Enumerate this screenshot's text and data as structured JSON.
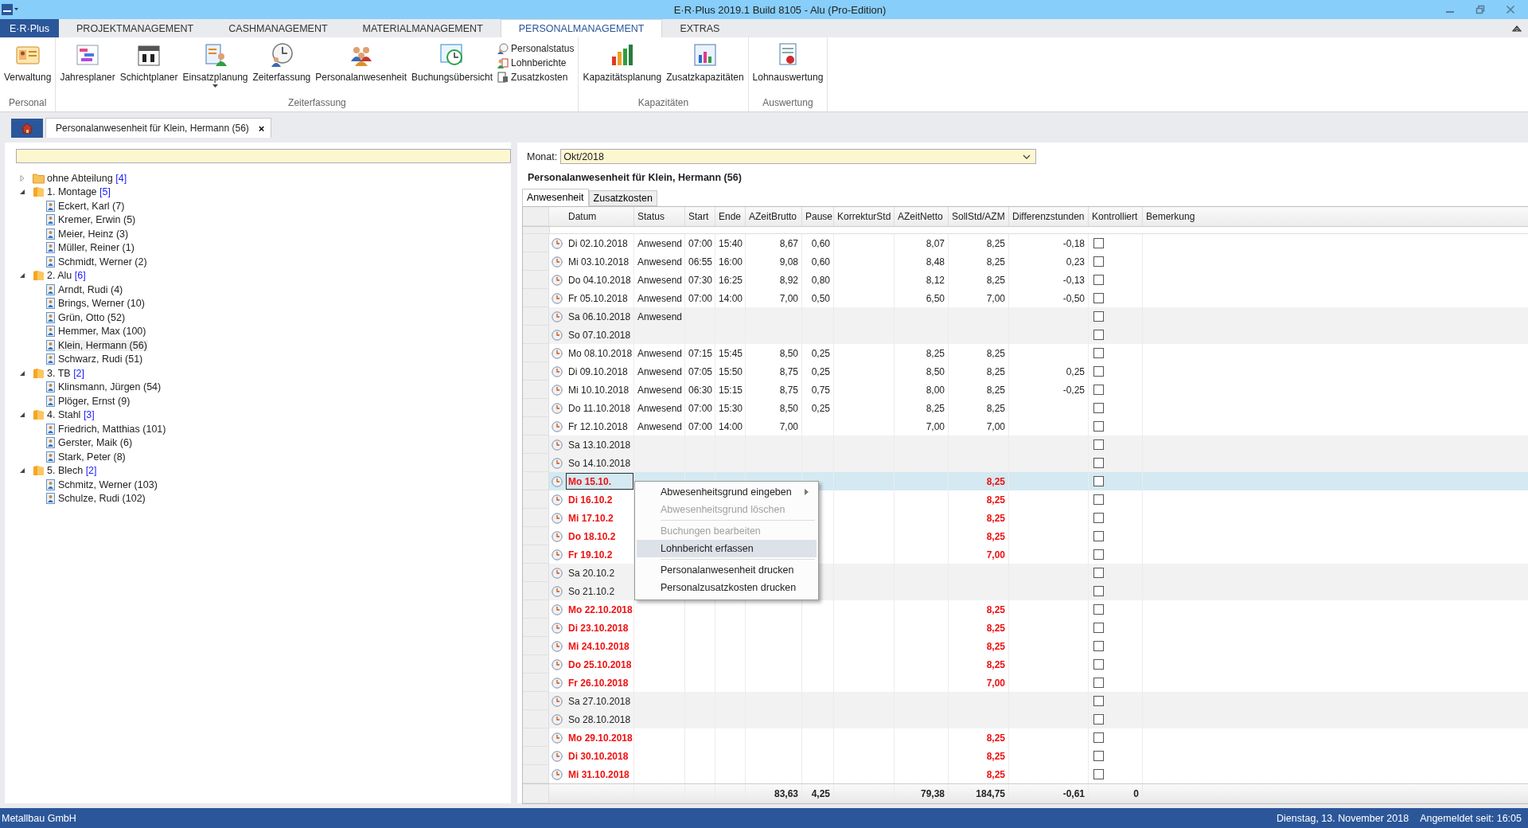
{
  "window": {
    "title": "E·R·Plus 2019.1 Build 8105 -  Alu (Pro-Edition)"
  },
  "menu_tabs": [
    {
      "label": "E·R·Plus",
      "kind": "file",
      "selected": false
    },
    {
      "label": "PROJEKTMANAGEMENT",
      "kind": "tab",
      "selected": false
    },
    {
      "label": "CASHMANAGEMENT",
      "kind": "tab",
      "selected": false
    },
    {
      "label": "MATERIALMANAGEMENT",
      "kind": "tab",
      "selected": false
    },
    {
      "label": "PERSONALMANAGEMENT",
      "kind": "tab",
      "selected": true
    },
    {
      "label": "EXTRAS",
      "kind": "tab",
      "selected": false
    }
  ],
  "ribbon": [
    {
      "label": "Personal",
      "buttons": [
        {
          "label": "Verwaltung",
          "kind": "large",
          "dropdown": false
        }
      ]
    },
    {
      "label": "Zeiterfassung",
      "buttons": [
        {
          "label": "Jahresplaner",
          "kind": "large",
          "dropdown": false
        },
        {
          "label": "Schichtplaner",
          "kind": "large",
          "dropdown": false
        },
        {
          "label": "Einsatzplanung",
          "kind": "large",
          "dropdown": true
        },
        {
          "label": "Zeiterfassung",
          "kind": "large",
          "dropdown": false
        },
        {
          "label": "Personalanwesenheit",
          "kind": "large",
          "dropdown": false
        },
        {
          "label": "Buchungsübersicht",
          "kind": "large",
          "dropdown": false
        },
        {
          "label": "Personalstatus",
          "kind": "small",
          "dropdown": false
        },
        {
          "label": "Lohnberichte",
          "kind": "small",
          "dropdown": false
        },
        {
          "label": "Zusatzkosten",
          "kind": "small",
          "dropdown": false
        }
      ]
    },
    {
      "label": "Kapazitäten",
      "buttons": [
        {
          "label": "Kapazitätsplanung",
          "kind": "large",
          "dropdown": false
        },
        {
          "label": "Zusatzkapazitäten",
          "kind": "large",
          "dropdown": false
        }
      ]
    },
    {
      "label": "Auswertung",
      "buttons": [
        {
          "label": "Lohnauswertung",
          "kind": "large",
          "dropdown": false
        }
      ]
    }
  ],
  "doc_tabs": [
    {
      "kind": "home",
      "selected": false
    },
    {
      "kind": "document",
      "label": "Personalanwesenheit für Klein, Hermann (56)",
      "close": "×",
      "selected": true
    }
  ],
  "tree": [
    {
      "label": "ohne Abteilung",
      "count": "[4]",
      "expanded": false
    },
    {
      "label": "1. Montage",
      "count": "[5]",
      "expanded": true,
      "children": [
        {
          "label": "Eckert, Karl (7)",
          "selected": false
        },
        {
          "label": "Kremer, Erwin (5)",
          "selected": false
        },
        {
          "label": "Meier, Heinz (3)",
          "selected": false
        },
        {
          "label": "Müller, Reiner (1)",
          "selected": false
        },
        {
          "label": "Schmidt, Werner (2)",
          "selected": false
        }
      ]
    },
    {
      "label": "2. Alu",
      "count": "[6]",
      "expanded": true,
      "children": [
        {
          "label": "Arndt, Rudi (4)",
          "selected": false
        },
        {
          "label": "Brings, Werner (10)",
          "selected": false
        },
        {
          "label": "Grün, Otto (52)",
          "selected": false
        },
        {
          "label": "Hemmer, Max (100)",
          "selected": false
        },
        {
          "label": "Klein, Hermann (56)",
          "selected": true
        },
        {
          "label": "Schwarz, Rudi (51)",
          "selected": false
        }
      ]
    },
    {
      "label": "3. TB",
      "count": "[2]",
      "expanded": true,
      "children": [
        {
          "label": "Klinsmann, Jürgen (54)",
          "selected": false
        },
        {
          "label": "Plöger, Ernst (9)",
          "selected": false
        }
      ]
    },
    {
      "label": "4. Stahl",
      "count": "[3]",
      "expanded": true,
      "children": [
        {
          "label": "Friedrich, Matthias (101)",
          "selected": false
        },
        {
          "label": "Gerster, Maik (6)",
          "selected": false
        },
        {
          "label": "Stark, Peter (8)",
          "selected": false
        }
      ]
    },
    {
      "label": "5. Blech",
      "count": "[2]",
      "expanded": true,
      "children": [
        {
          "label": "Schmitz, Werner (103)",
          "selected": false
        },
        {
          "label": "Schulze, Rudi (102)",
          "selected": false
        }
      ]
    }
  ],
  "month": {
    "label": "Monat:",
    "value": "Okt/2018"
  },
  "heading": "Personalanwesenheit für Klein, Hermann (56)",
  "sub_tabs": [
    {
      "label": "Anwesenheit",
      "selected": true
    },
    {
      "label": "Zusatzkosten",
      "selected": false
    }
  ],
  "table": {
    "columns": [
      "Datum",
      "Status",
      "Start",
      "Ende",
      "AZeitBrutto",
      "Pause",
      "KorrekturStd",
      "AZeitNetto",
      "SollStd/AZM",
      "Differenzstunden",
      "Kontrolliert",
      "Bemerkung"
    ],
    "rows": [
      {
        "kind": "workday",
        "selected": false,
        "checked": false,
        "datum": "Di 02.10.2018",
        "status": "Anwesend",
        "start": "07:00",
        "ende": "15:40",
        "brutto": "8,67",
        "pause": "0,60",
        "netto": "8,07",
        "soll": "8,25",
        "diff": "-0,18"
      },
      {
        "kind": "workday",
        "selected": false,
        "checked": false,
        "datum": "Mi 03.10.2018",
        "status": "Anwesend",
        "start": "06:55",
        "ende": "16:00",
        "brutto": "9,08",
        "pause": "0,60",
        "netto": "8,48",
        "soll": "8,25",
        "diff": "0,23"
      },
      {
        "kind": "workday",
        "selected": false,
        "checked": false,
        "datum": "Do 04.10.2018",
        "status": "Anwesend",
        "start": "07:30",
        "ende": "16:25",
        "brutto": "8,92",
        "pause": "0,80",
        "netto": "8,12",
        "soll": "8,25",
        "diff": "-0,13"
      },
      {
        "kind": "workday",
        "selected": false,
        "checked": false,
        "datum": "Fr 05.10.2018",
        "status": "Anwesend",
        "start": "07:00",
        "ende": "14:00",
        "brutto": "7,00",
        "pause": "0,50",
        "netto": "6,50",
        "soll": "7,00",
        "diff": "-0,50"
      },
      {
        "kind": "weekend",
        "selected": false,
        "checked": false,
        "datum": "Sa 06.10.2018",
        "status": "Anwesend"
      },
      {
        "kind": "weekend",
        "selected": false,
        "checked": false,
        "datum": "So 07.10.2018"
      },
      {
        "kind": "workday",
        "selected": false,
        "checked": false,
        "datum": "Mo 08.10.2018",
        "status": "Anwesend",
        "start": "07:15",
        "ende": "15:45",
        "brutto": "8,50",
        "pause": "0,25",
        "netto": "8,25",
        "soll": "8,25"
      },
      {
        "kind": "workday",
        "selected": false,
        "checked": false,
        "datum": "Di 09.10.2018",
        "status": "Anwesend",
        "start": "07:05",
        "ende": "15:50",
        "brutto": "8,75",
        "pause": "0,25",
        "netto": "8,50",
        "soll": "8,25",
        "diff": "0,25"
      },
      {
        "kind": "workday",
        "selected": false,
        "checked": false,
        "datum": "Mi 10.10.2018",
        "status": "Anwesend",
        "start": "06:30",
        "ende": "15:15",
        "brutto": "8,75",
        "pause": "0,75",
        "netto": "8,00",
        "soll": "8,25",
        "diff": "-0,25"
      },
      {
        "kind": "workday",
        "selected": false,
        "checked": false,
        "datum": "Do 11.10.2018",
        "status": "Anwesend",
        "start": "07:00",
        "ende": "15:30",
        "brutto": "8,50",
        "pause": "0,25",
        "netto": "8,25",
        "soll": "8,25"
      },
      {
        "kind": "workday",
        "selected": false,
        "checked": false,
        "datum": "Fr 12.10.2018",
        "status": "Anwesend",
        "start": "07:00",
        "ende": "14:00",
        "brutto": "7,00",
        "netto": "7,00",
        "soll": "7,00"
      },
      {
        "kind": "weekend",
        "selected": false,
        "checked": false,
        "datum": "Sa 13.10.2018"
      },
      {
        "kind": "weekend",
        "selected": false,
        "checked": false,
        "datum": "So 14.10.2018"
      },
      {
        "kind": "absent",
        "selected": true,
        "checked": false,
        "datum": "Mo 15.10.",
        "soll": "8,25"
      },
      {
        "kind": "absent",
        "selected": false,
        "checked": false,
        "datum": "Di 16.10.2",
        "soll": "8,25"
      },
      {
        "kind": "absent",
        "selected": false,
        "checked": false,
        "datum": "Mi 17.10.2",
        "soll": "8,25"
      },
      {
        "kind": "absent",
        "selected": false,
        "checked": false,
        "datum": "Do 18.10.2",
        "soll": "8,25"
      },
      {
        "kind": "absent",
        "selected": false,
        "checked": false,
        "datum": "Fr 19.10.2",
        "soll": "7,00"
      },
      {
        "kind": "weekend",
        "selected": false,
        "checked": false,
        "datum": "Sa 20.10.2"
      },
      {
        "kind": "weekend",
        "selected": false,
        "checked": false,
        "datum": "So 21.10.2"
      },
      {
        "kind": "absent",
        "selected": false,
        "checked": false,
        "datum": "Mo 22.10.2018",
        "soll": "8,25"
      },
      {
        "kind": "absent",
        "selected": false,
        "checked": false,
        "datum": "Di 23.10.2018",
        "soll": "8,25"
      },
      {
        "kind": "absent",
        "selected": false,
        "checked": false,
        "datum": "Mi 24.10.2018",
        "soll": "8,25"
      },
      {
        "kind": "absent",
        "selected": false,
        "checked": false,
        "datum": "Do 25.10.2018",
        "soll": "8,25"
      },
      {
        "kind": "absent",
        "selected": false,
        "checked": false,
        "datum": "Fr 26.10.2018",
        "soll": "7,00"
      },
      {
        "kind": "weekend",
        "selected": false,
        "checked": false,
        "datum": "Sa 27.10.2018"
      },
      {
        "kind": "weekend",
        "selected": false,
        "checked": false,
        "datum": "So 28.10.2018"
      },
      {
        "kind": "absent",
        "selected": false,
        "checked": false,
        "datum": "Mo 29.10.2018",
        "soll": "8,25"
      },
      {
        "kind": "absent",
        "selected": false,
        "checked": false,
        "datum": "Di 30.10.2018",
        "soll": "8,25"
      },
      {
        "kind": "absent",
        "selected": false,
        "checked": false,
        "datum": "Mi 31.10.2018",
        "soll": "8,25"
      }
    ],
    "totals": {
      "brutto": "83,63",
      "pause": "4,25",
      "netto": "79,38",
      "soll": "184,75",
      "diff": "-0,61",
      "kontrolliert": "0"
    }
  },
  "context_menu": {
    "groups": [
      [
        {
          "label": "Abwesenheitsgrund eingeben",
          "disabled": false,
          "selected": false,
          "submenu": true
        },
        {
          "label": "Abwesenheitsgrund löschen",
          "disabled": true,
          "selected": false,
          "submenu": false
        }
      ],
      [
        {
          "label": "Buchungen bearbeiten",
          "disabled": true,
          "selected": false,
          "submenu": false
        },
        {
          "label": "Lohnbericht erfassen",
          "disabled": false,
          "selected": true,
          "submenu": false
        }
      ],
      [
        {
          "label": "Personalanwesenheit drucken",
          "disabled": false,
          "selected": false,
          "submenu": false
        },
        {
          "label": "Personalzusatzkosten drucken",
          "disabled": false,
          "selected": false,
          "submenu": false
        }
      ]
    ]
  },
  "status_bar": {
    "company": "Metallbau GmbH",
    "date": "Dienstag, 13. November 2018",
    "login": "Angemeldet seit: 16:05"
  }
}
